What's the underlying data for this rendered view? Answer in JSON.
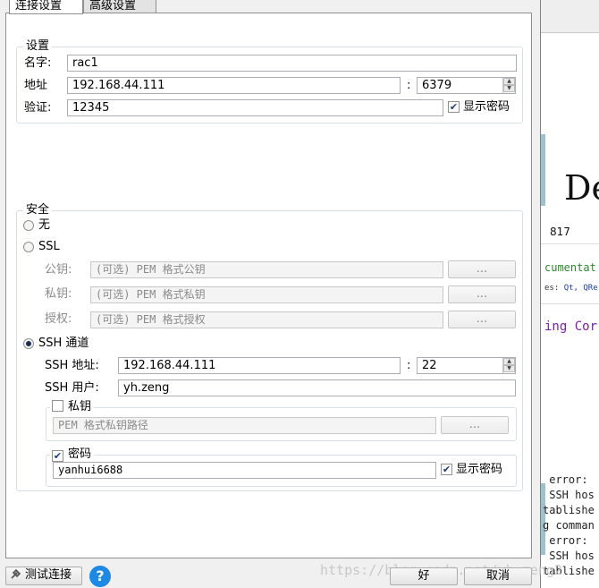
{
  "tabs": [
    {
      "label": "连接设置",
      "active": true
    },
    {
      "label": "高级设置",
      "active": false
    }
  ],
  "settings": {
    "title": "设置",
    "name_label": "名字:",
    "name_value": "rac1",
    "address_label": "地址",
    "address_value": "192.168.44.111",
    "port_colon": ":",
    "port_value": "6379",
    "auth_label": "验证:",
    "auth_value": "12345",
    "show_password_label": "显示密码",
    "show_password_checked": true
  },
  "security": {
    "title": "安全",
    "options": {
      "none": {
        "label": "无",
        "selected": false
      },
      "ssl": {
        "label": "SSL",
        "selected": false
      },
      "ssh": {
        "label": "SSH 通道",
        "selected": true
      }
    },
    "ssl": {
      "public_key_label": "公钥:",
      "public_key_placeholder": "(可选) PEM 格式公钥",
      "private_key_label": "私钥:",
      "private_key_placeholder": "(可选) PEM 格式私钥",
      "authority_label": "授权:",
      "authority_placeholder": "(可选) PEM 格式授权",
      "browse_label": "..."
    },
    "ssh": {
      "address_label": "SSH 地址:",
      "address_value": "192.168.44.111",
      "port_colon": ":",
      "port_value": "22",
      "user_label": "SSH 用户:",
      "user_value": "yh.zeng",
      "private_key_title": "私钥",
      "private_key_checked": false,
      "private_key_placeholder": "PEM 格式私钥路径",
      "browse_label": "...",
      "password_title": "密码",
      "password_checked": true,
      "password_value": "yanhui6688",
      "show_password_label": "显示密码",
      "show_password_checked": true
    }
  },
  "footer": {
    "test_label": "测试连接",
    "help_icon_text": "?",
    "ok_label": "好",
    "cancel_label": "取消",
    "watermark": "https://blog.csdn.net/yh_zeng2"
  },
  "background_window": {
    "big_text": "De",
    "number": "817",
    "link_text": "cumentat",
    "keywords_prefix": "es: ",
    "keywords": "Qt, QRe",
    "command_text": "ing Cor",
    "log_lines": [
      " error:",
      " SSH hos",
      "tablishe",
      "g comman",
      " error:",
      " SSH hos",
      "tablishe"
    ]
  },
  "colors": {
    "group_border": "#d5dfe5",
    "help_blue": "#1e88e5",
    "link_green": "#2a8a2a",
    "command_purple": "#7a1fa8"
  }
}
